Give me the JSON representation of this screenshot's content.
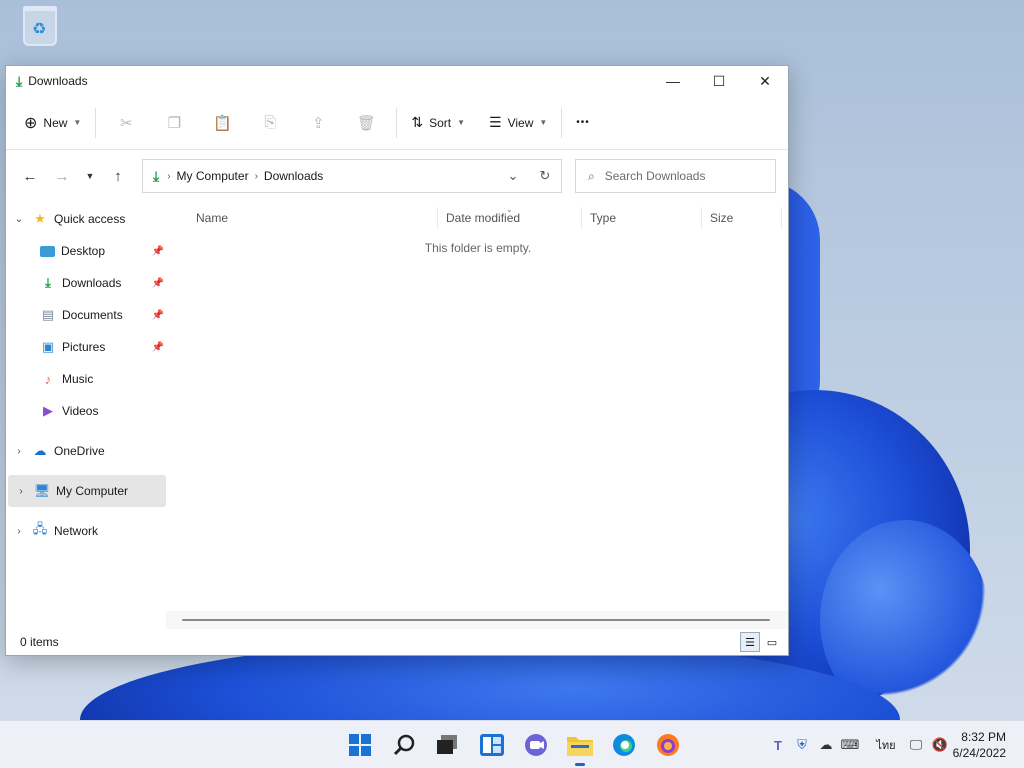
{
  "desktop": {
    "recycle_bin_label": "Recycle Bin"
  },
  "window": {
    "title": "Downloads",
    "controls": {
      "minimize": "—",
      "maximize": "☐",
      "close": "✕"
    }
  },
  "toolbar": {
    "new_label": "New",
    "sort_label": "Sort",
    "view_label": "View",
    "more_label": "•••"
  },
  "address": {
    "crumbs": [
      "My Computer",
      "Downloads"
    ]
  },
  "search": {
    "placeholder": "Search Downloads"
  },
  "nav": {
    "quick_access": "Quick access",
    "quick_items": [
      "Desktop",
      "Downloads",
      "Documents",
      "Pictures",
      "Music",
      "Videos"
    ],
    "onedrive": "OneDrive",
    "my_computer": "My Computer",
    "network": "Network"
  },
  "columns": [
    "Name",
    "Date modified",
    "Type",
    "Size"
  ],
  "empty_message": "This folder is empty.",
  "status": {
    "items": "0 items"
  },
  "taskbar": {
    "language": "ไทย",
    "time": "8:32 PM",
    "date": "6/24/2022"
  },
  "colors": {
    "accent": "#1867c9",
    "download_green": "#2a9d4a",
    "folder_yellow": "#f3c43b"
  }
}
